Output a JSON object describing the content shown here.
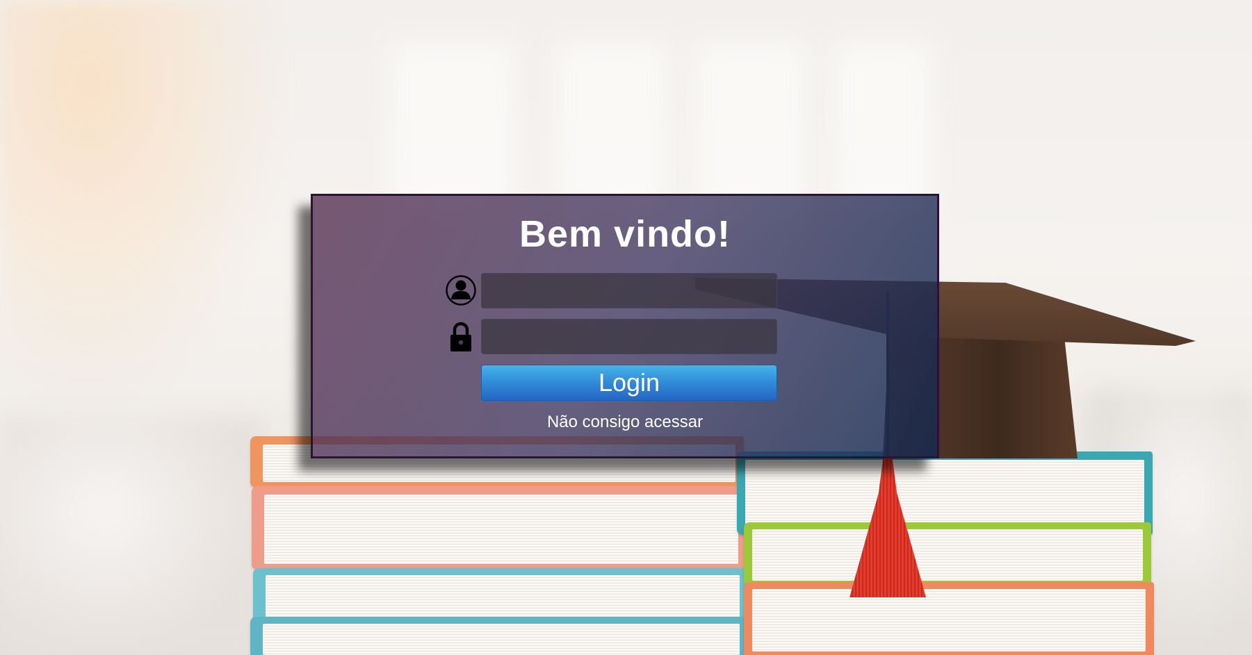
{
  "login": {
    "title": "Bem vindo!",
    "username": {
      "icon": "user-icon",
      "value": "",
      "placeholder": ""
    },
    "password": {
      "icon": "lock-icon",
      "value": "",
      "placeholder": ""
    },
    "login_label": "Login",
    "forgot_label": "Não consigo acessar"
  },
  "colors": {
    "button_top": "#45b4e8",
    "button_bottom": "#2467c4",
    "panel_border": "#2b1236",
    "text": "#ffffff"
  }
}
